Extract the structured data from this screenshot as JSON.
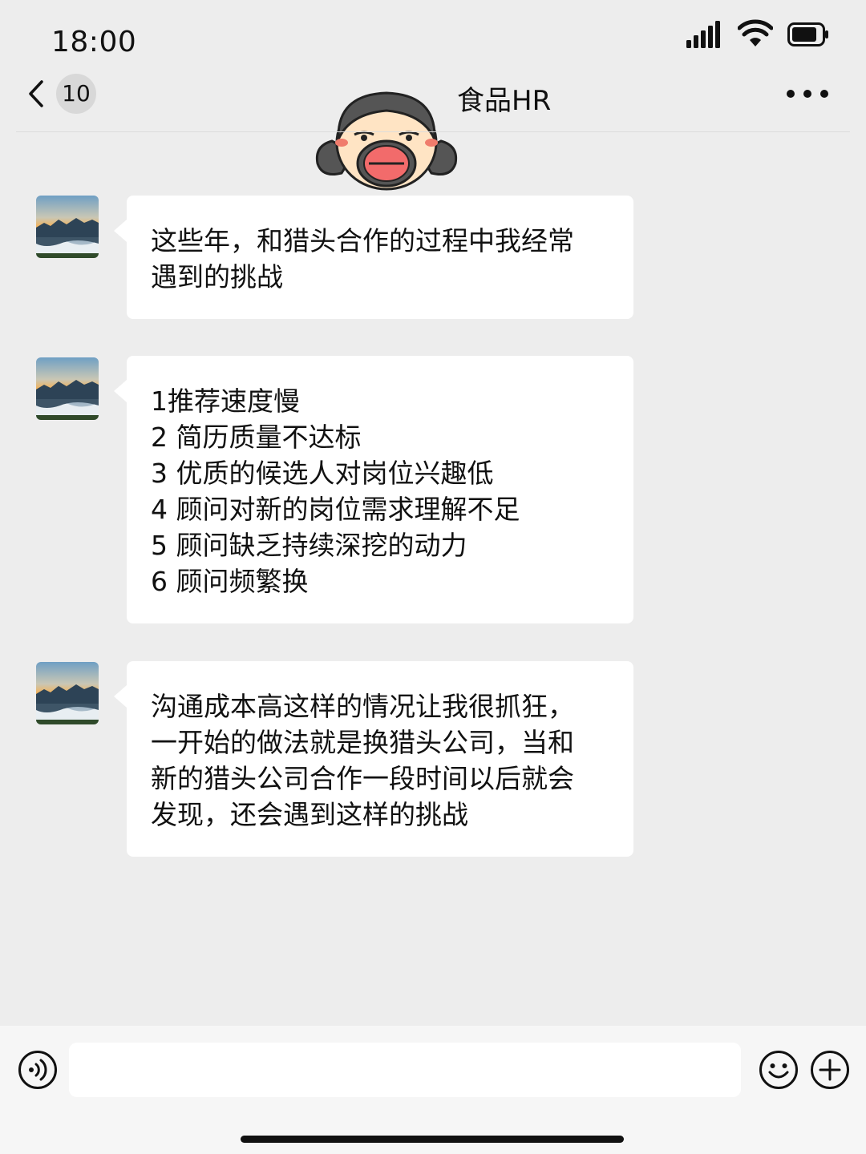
{
  "status_bar": {
    "time": "18:00",
    "icons": [
      "signal-icon",
      "wifi-icon",
      "battery-icon"
    ]
  },
  "header": {
    "back_icon": "chevron-left-icon",
    "unread_count": "10",
    "title": "食品HR",
    "more_icon": "more-horizontal-icon"
  },
  "messages": [
    {
      "sender": "other",
      "lines": [
        "这些年，和猎头合作的过程中我经常",
        "遇到的挑战"
      ]
    },
    {
      "sender": "other",
      "lines": [
        "1推荐速度慢",
        "2 简历质量不达标",
        "3 优质的候选人对岗位兴趣低",
        "4 顾问对新的岗位需求理解不足",
        "5 顾问缺乏持续深挖的动力",
        "6 顾问频繁换"
      ]
    },
    {
      "sender": "other",
      "lines": [
        "沟通成本高这样的情况让我很抓狂，",
        "一开始的做法就是换猎头公司，当和",
        "新的猎头公司合作一段时间以后就会",
        "发现，还会遇到这样的挑战"
      ]
    }
  ],
  "input_bar": {
    "voice_icon": "voice-icon",
    "input_value": "",
    "emoji_icon": "emoji-icon",
    "plus_icon": "plus-circle-icon"
  },
  "colors": {
    "background": "#ededed",
    "bubble": "#ffffff",
    "text": "#111111",
    "input_bar": "#f6f6f6"
  }
}
